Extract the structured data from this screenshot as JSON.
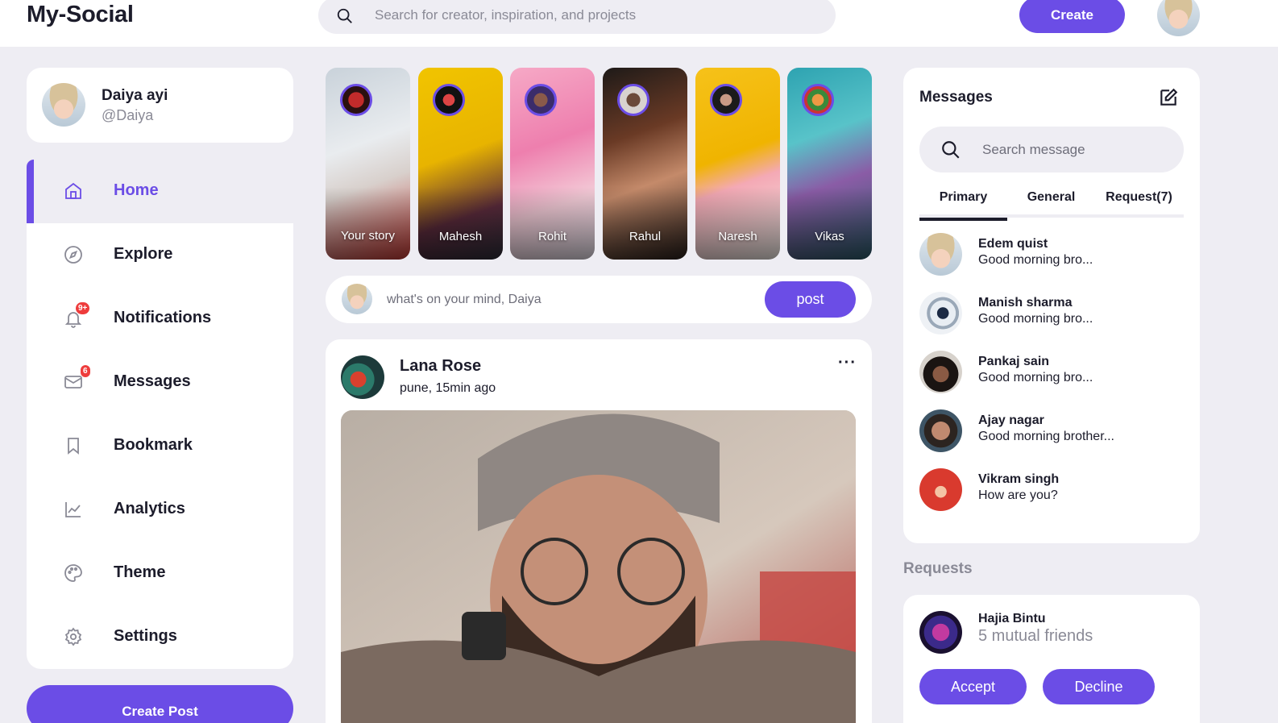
{
  "brand": {
    "logo": "My-Social",
    "accent": "#6b4de6"
  },
  "topbar": {
    "search_placeholder": "Search for creator, inspiration, and projects",
    "create_label": "Create"
  },
  "profile": {
    "name": "Daiya ayi",
    "handle": "@Daiya"
  },
  "sidebar": {
    "items": [
      {
        "label": "Home",
        "icon": "home-icon",
        "active": true
      },
      {
        "label": "Explore",
        "icon": "compass-icon"
      },
      {
        "label": "Notifications",
        "icon": "bell-icon",
        "badge": "9+"
      },
      {
        "label": "Messages",
        "icon": "mail-icon",
        "badge": "6"
      },
      {
        "label": "Bookmark",
        "icon": "bookmark-icon"
      },
      {
        "label": "Analytics",
        "icon": "chart-icon"
      },
      {
        "label": "Theme",
        "icon": "palette-icon"
      },
      {
        "label": "Settings",
        "icon": "gear-icon"
      }
    ],
    "create_post_label": "Create Post"
  },
  "stories": [
    {
      "name": "Your story"
    },
    {
      "name": "Mahesh"
    },
    {
      "name": "Rohit"
    },
    {
      "name": "Rahul"
    },
    {
      "name": "Naresh"
    },
    {
      "name": "Vikas"
    }
  ],
  "composer": {
    "placeholder": "what's on your mind, Daiya",
    "post_label": "post"
  },
  "feed": [
    {
      "author": "Lana Rose",
      "meta": "pune, 15min ago",
      "more": "···"
    }
  ],
  "messages": {
    "title": "Messages",
    "search_placeholder": "Search message",
    "tabs": [
      "Primary",
      "General",
      "Request(7)"
    ],
    "items": [
      {
        "name": "Edem quist",
        "text": "Good morning bro..."
      },
      {
        "name": "Manish sharma",
        "text": "Good morning bro..."
      },
      {
        "name": "Pankaj sain",
        "text": "Good morning bro..."
      },
      {
        "name": "Ajay nagar",
        "text": "Good morning brother..."
      },
      {
        "name": "Vikram singh",
        "text": "How are you?"
      }
    ]
  },
  "requests": {
    "title": "Requests",
    "items": [
      {
        "name": "Hajia Bintu",
        "mutual": "5 mutual friends",
        "accept_label": "Accept",
        "decline_label": "Decline"
      }
    ]
  }
}
